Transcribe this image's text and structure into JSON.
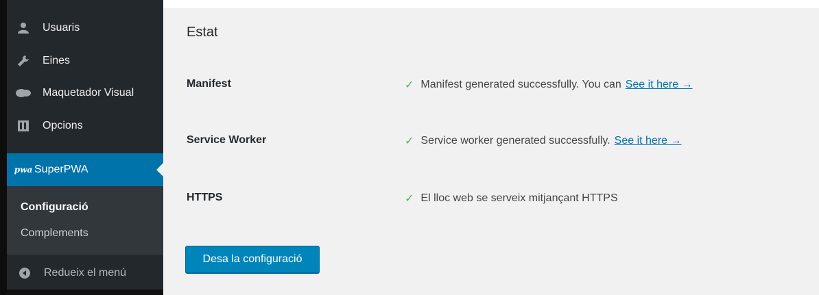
{
  "sidebar": {
    "items": [
      {
        "label": "Usuaris",
        "icon": "users-icon"
      },
      {
        "label": "Eines",
        "icon": "wrench-icon"
      },
      {
        "label": "Maquetador Visual",
        "icon": "chat-bubble-icon"
      },
      {
        "label": "Opcions",
        "icon": "settings-grid-icon"
      },
      {
        "label": "SuperPWA",
        "icon": "superpwa-logo-icon"
      }
    ],
    "submenu": [
      {
        "label": "Configuració"
      },
      {
        "label": "Complements"
      }
    ],
    "collapse_label": "Redueix el menú"
  },
  "main": {
    "section_title": "Estat",
    "rows": [
      {
        "label": "Manifest",
        "status": "Manifest generated successfully. You can",
        "link": "See it here →"
      },
      {
        "label": "Service Worker",
        "status": "Service worker generated successfully.",
        "link": "See it here →"
      },
      {
        "label": "HTTPS",
        "status": "El lloc web se serveix mitjançant HTTPS",
        "link": ""
      }
    ],
    "save_label": "Desa la configuració"
  },
  "colors": {
    "sidebar_bg": "#23282d",
    "active_bg": "#0073aa",
    "submenu_bg": "#32373c",
    "content_bg": "#f1f1f1",
    "check": "#46b450",
    "link": "#0073aa",
    "button": "#0085ba"
  },
  "icons": {
    "check": "✓",
    "logo_text": "pwa"
  }
}
